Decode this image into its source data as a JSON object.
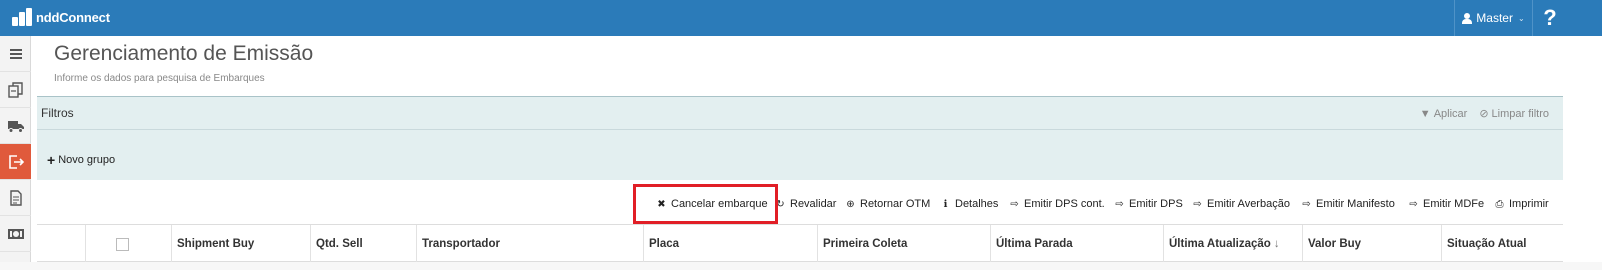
{
  "app": {
    "name": "nddConnect",
    "brand_color": "#2b7bb9",
    "accent_active": "#e05a3c"
  },
  "header": {
    "user_label": "Master",
    "help_label": "?"
  },
  "sidebar": {
    "items": [
      {
        "icon": "menu-icon",
        "active": false
      },
      {
        "icon": "documents-icon",
        "active": false
      },
      {
        "icon": "truck-icon",
        "active": false
      },
      {
        "icon": "exit-icon",
        "active": true
      },
      {
        "icon": "file-icon",
        "active": false
      },
      {
        "icon": "money-icon",
        "active": false
      }
    ]
  },
  "page": {
    "title": "Gerenciamento de Emissão",
    "subtitle": "Informe os dados para pesquisa de Embarques"
  },
  "filters": {
    "label": "Filtros",
    "apply_label": "Aplicar",
    "clear_label": "Limpar filtro",
    "new_group_label": "Novo grupo"
  },
  "toolbar": {
    "cancel": "Cancelar embarque",
    "revalidate": "Revalidar",
    "return_otm": "Retornar OTM",
    "details": "Detalhes",
    "emit_dps_cont": "Emitir DPS cont.",
    "emit_dps": "Emitir DPS",
    "emit_averbacao": "Emitir Averbação",
    "emit_manifesto": "Emitir Manifesto",
    "emit_mdfe": "Emitir MDFe",
    "print": "Imprimir"
  },
  "table": {
    "columns": [
      "Shipment Buy",
      "Qtd. Sell",
      "Transportador",
      "Placa",
      "Primeira Coleta",
      "Última Parada",
      "Última Atualização",
      "Valor Buy",
      "Situação Atual"
    ],
    "sort_arrow": "↓"
  },
  "highlight_color": "#e11e26"
}
